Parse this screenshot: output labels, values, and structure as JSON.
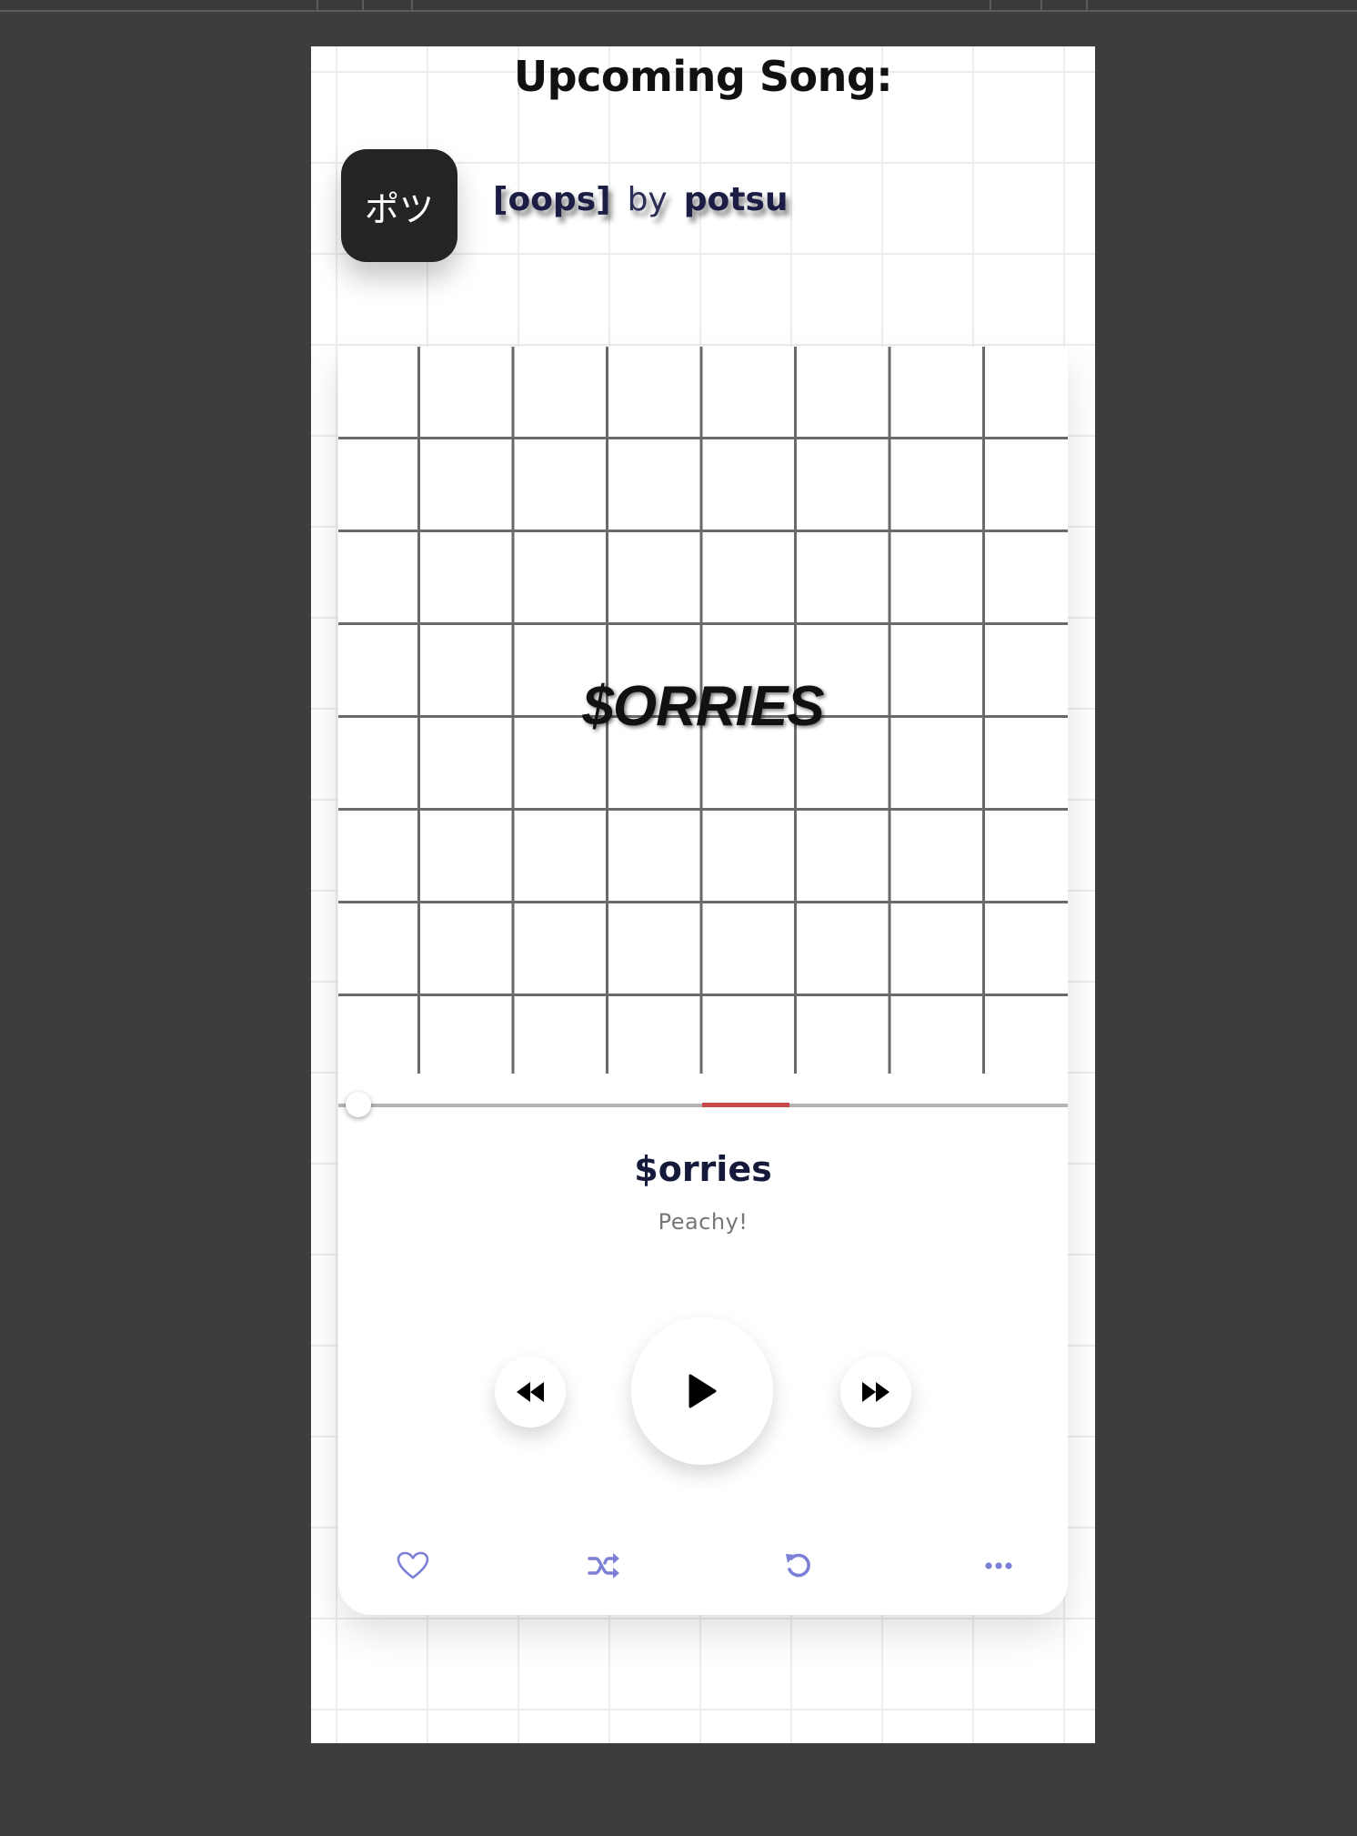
{
  "upcoming": {
    "heading": "Upcoming Song:",
    "badge_text": "ポツ",
    "song": "[oops]",
    "by": "by",
    "artist": "potsu"
  },
  "player": {
    "cover_text": "$ORRIES",
    "title": "$orries",
    "artist": "Peachy!",
    "progress_fraction": 0.0,
    "accent_color": "#7b7fd6",
    "progress_mark_color": "#c64a4a"
  },
  "controls": {
    "rewind_icon": "rewind-icon",
    "play_icon": "play-icon",
    "forward_icon": "fast-forward-icon"
  },
  "actions": {
    "like_icon": "heart-icon",
    "shuffle_icon": "shuffle-icon",
    "repeat_icon": "repeat-icon",
    "more_icon": "more-icon"
  }
}
